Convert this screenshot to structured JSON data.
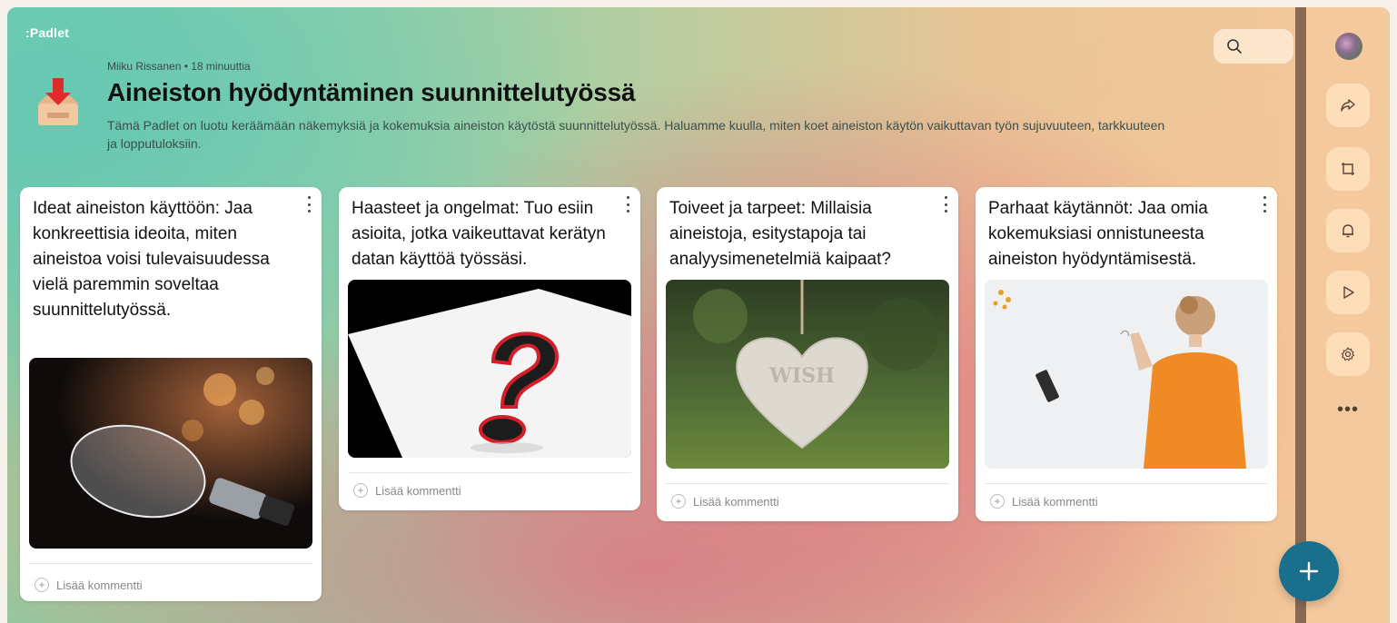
{
  "app": {
    "logo": ":Padlet"
  },
  "header": {
    "meta": "Miiku Rissanen • 18 minuuttia",
    "title": "Aineiston hyödyntäminen suunnittelutyössä",
    "description": "Tämä Padlet on luotu keräämään näkemyksiä ja kokemuksia aineiston käytöstä suunnittelutyössä. Haluamme kuulla, miten koet aineiston käytön vaikuttavan työn sujuvuuteen, tarkkuuteen ja lopputuloksiin."
  },
  "sidebar": {
    "buttons": [
      {
        "icon": "share-icon"
      },
      {
        "icon": "remake-icon"
      },
      {
        "icon": "bell-icon"
      },
      {
        "icon": "play-icon"
      },
      {
        "icon": "gear-icon"
      },
      {
        "icon": "more-icon",
        "label": "•••"
      }
    ]
  },
  "posts": [
    {
      "title": "Ideat aineiston käyttöön: Jaa konkreettisia ideoita, miten aineistoa voisi tulevaisuudessa vielä paremmin soveltaa suunnittelutyössä.",
      "image": "lightbulb-photo",
      "comment_label": "Lisää kommentti"
    },
    {
      "title": "Haasteet ja ongelmat: Tuo esiin asioita, jotka vaikeuttavat kerätyn datan käyttöä työssäsi.",
      "image": "question-mark-photo",
      "comment_label": "Lisää kommentti"
    },
    {
      "title": "Toiveet ja tarpeet: Millaisia aineistoja, esitystapoja tai analyysimenetelmiä kaipaat?",
      "image": "wish-heart-photo",
      "image_text": "WISH",
      "comment_label": "Lisää kommentti"
    },
    {
      "title": "Parhaat käytännöt: Jaa omia kokemuksiasi onnistuneesta aineiston hyödyntämisestä.",
      "image": "child-drawing-photo",
      "comment_label": "Lisää kommentti"
    }
  ],
  "fab": {
    "label": "+"
  }
}
